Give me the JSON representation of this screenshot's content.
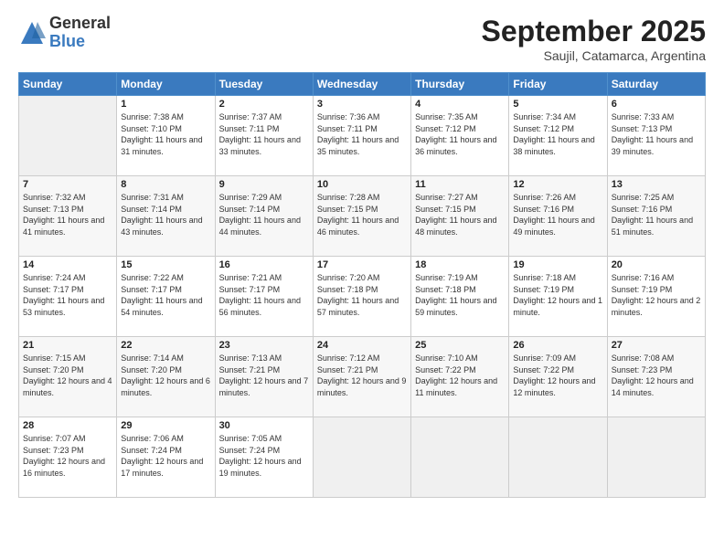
{
  "header": {
    "logo_line1": "General",
    "logo_line2": "Blue",
    "month": "September 2025",
    "location": "Saujil, Catamarca, Argentina"
  },
  "days_of_week": [
    "Sunday",
    "Monday",
    "Tuesday",
    "Wednesday",
    "Thursday",
    "Friday",
    "Saturday"
  ],
  "weeks": [
    [
      {
        "day": "",
        "empty": true
      },
      {
        "day": "1",
        "sunrise": "7:38 AM",
        "sunset": "7:10 PM",
        "daylight": "11 hours and 31 minutes."
      },
      {
        "day": "2",
        "sunrise": "7:37 AM",
        "sunset": "7:11 PM",
        "daylight": "11 hours and 33 minutes."
      },
      {
        "day": "3",
        "sunrise": "7:36 AM",
        "sunset": "7:11 PM",
        "daylight": "11 hours and 35 minutes."
      },
      {
        "day": "4",
        "sunrise": "7:35 AM",
        "sunset": "7:12 PM",
        "daylight": "11 hours and 36 minutes."
      },
      {
        "day": "5",
        "sunrise": "7:34 AM",
        "sunset": "7:12 PM",
        "daylight": "11 hours and 38 minutes."
      },
      {
        "day": "6",
        "sunrise": "7:33 AM",
        "sunset": "7:13 PM",
        "daylight": "11 hours and 39 minutes."
      }
    ],
    [
      {
        "day": "7",
        "sunrise": "7:32 AM",
        "sunset": "7:13 PM",
        "daylight": "11 hours and 41 minutes."
      },
      {
        "day": "8",
        "sunrise": "7:31 AM",
        "sunset": "7:14 PM",
        "daylight": "11 hours and 43 minutes."
      },
      {
        "day": "9",
        "sunrise": "7:29 AM",
        "sunset": "7:14 PM",
        "daylight": "11 hours and 44 minutes."
      },
      {
        "day": "10",
        "sunrise": "7:28 AM",
        "sunset": "7:15 PM",
        "daylight": "11 hours and 46 minutes."
      },
      {
        "day": "11",
        "sunrise": "7:27 AM",
        "sunset": "7:15 PM",
        "daylight": "11 hours and 48 minutes."
      },
      {
        "day": "12",
        "sunrise": "7:26 AM",
        "sunset": "7:16 PM",
        "daylight": "11 hours and 49 minutes."
      },
      {
        "day": "13",
        "sunrise": "7:25 AM",
        "sunset": "7:16 PM",
        "daylight": "11 hours and 51 minutes."
      }
    ],
    [
      {
        "day": "14",
        "sunrise": "7:24 AM",
        "sunset": "7:17 PM",
        "daylight": "11 hours and 53 minutes."
      },
      {
        "day": "15",
        "sunrise": "7:22 AM",
        "sunset": "7:17 PM",
        "daylight": "11 hours and 54 minutes."
      },
      {
        "day": "16",
        "sunrise": "7:21 AM",
        "sunset": "7:17 PM",
        "daylight": "11 hours and 56 minutes."
      },
      {
        "day": "17",
        "sunrise": "7:20 AM",
        "sunset": "7:18 PM",
        "daylight": "11 hours and 57 minutes."
      },
      {
        "day": "18",
        "sunrise": "7:19 AM",
        "sunset": "7:18 PM",
        "daylight": "11 hours and 59 minutes."
      },
      {
        "day": "19",
        "sunrise": "7:18 AM",
        "sunset": "7:19 PM",
        "daylight": "12 hours and 1 minute."
      },
      {
        "day": "20",
        "sunrise": "7:16 AM",
        "sunset": "7:19 PM",
        "daylight": "12 hours and 2 minutes."
      }
    ],
    [
      {
        "day": "21",
        "sunrise": "7:15 AM",
        "sunset": "7:20 PM",
        "daylight": "12 hours and 4 minutes."
      },
      {
        "day": "22",
        "sunrise": "7:14 AM",
        "sunset": "7:20 PM",
        "daylight": "12 hours and 6 minutes."
      },
      {
        "day": "23",
        "sunrise": "7:13 AM",
        "sunset": "7:21 PM",
        "daylight": "12 hours and 7 minutes."
      },
      {
        "day": "24",
        "sunrise": "7:12 AM",
        "sunset": "7:21 PM",
        "daylight": "12 hours and 9 minutes."
      },
      {
        "day": "25",
        "sunrise": "7:10 AM",
        "sunset": "7:22 PM",
        "daylight": "12 hours and 11 minutes."
      },
      {
        "day": "26",
        "sunrise": "7:09 AM",
        "sunset": "7:22 PM",
        "daylight": "12 hours and 12 minutes."
      },
      {
        "day": "27",
        "sunrise": "7:08 AM",
        "sunset": "7:23 PM",
        "daylight": "12 hours and 14 minutes."
      }
    ],
    [
      {
        "day": "28",
        "sunrise": "7:07 AM",
        "sunset": "7:23 PM",
        "daylight": "12 hours and 16 minutes."
      },
      {
        "day": "29",
        "sunrise": "7:06 AM",
        "sunset": "7:24 PM",
        "daylight": "12 hours and 17 minutes."
      },
      {
        "day": "30",
        "sunrise": "7:05 AM",
        "sunset": "7:24 PM",
        "daylight": "12 hours and 19 minutes."
      },
      {
        "day": "",
        "empty": true
      },
      {
        "day": "",
        "empty": true
      },
      {
        "day": "",
        "empty": true
      },
      {
        "day": "",
        "empty": true
      }
    ]
  ]
}
